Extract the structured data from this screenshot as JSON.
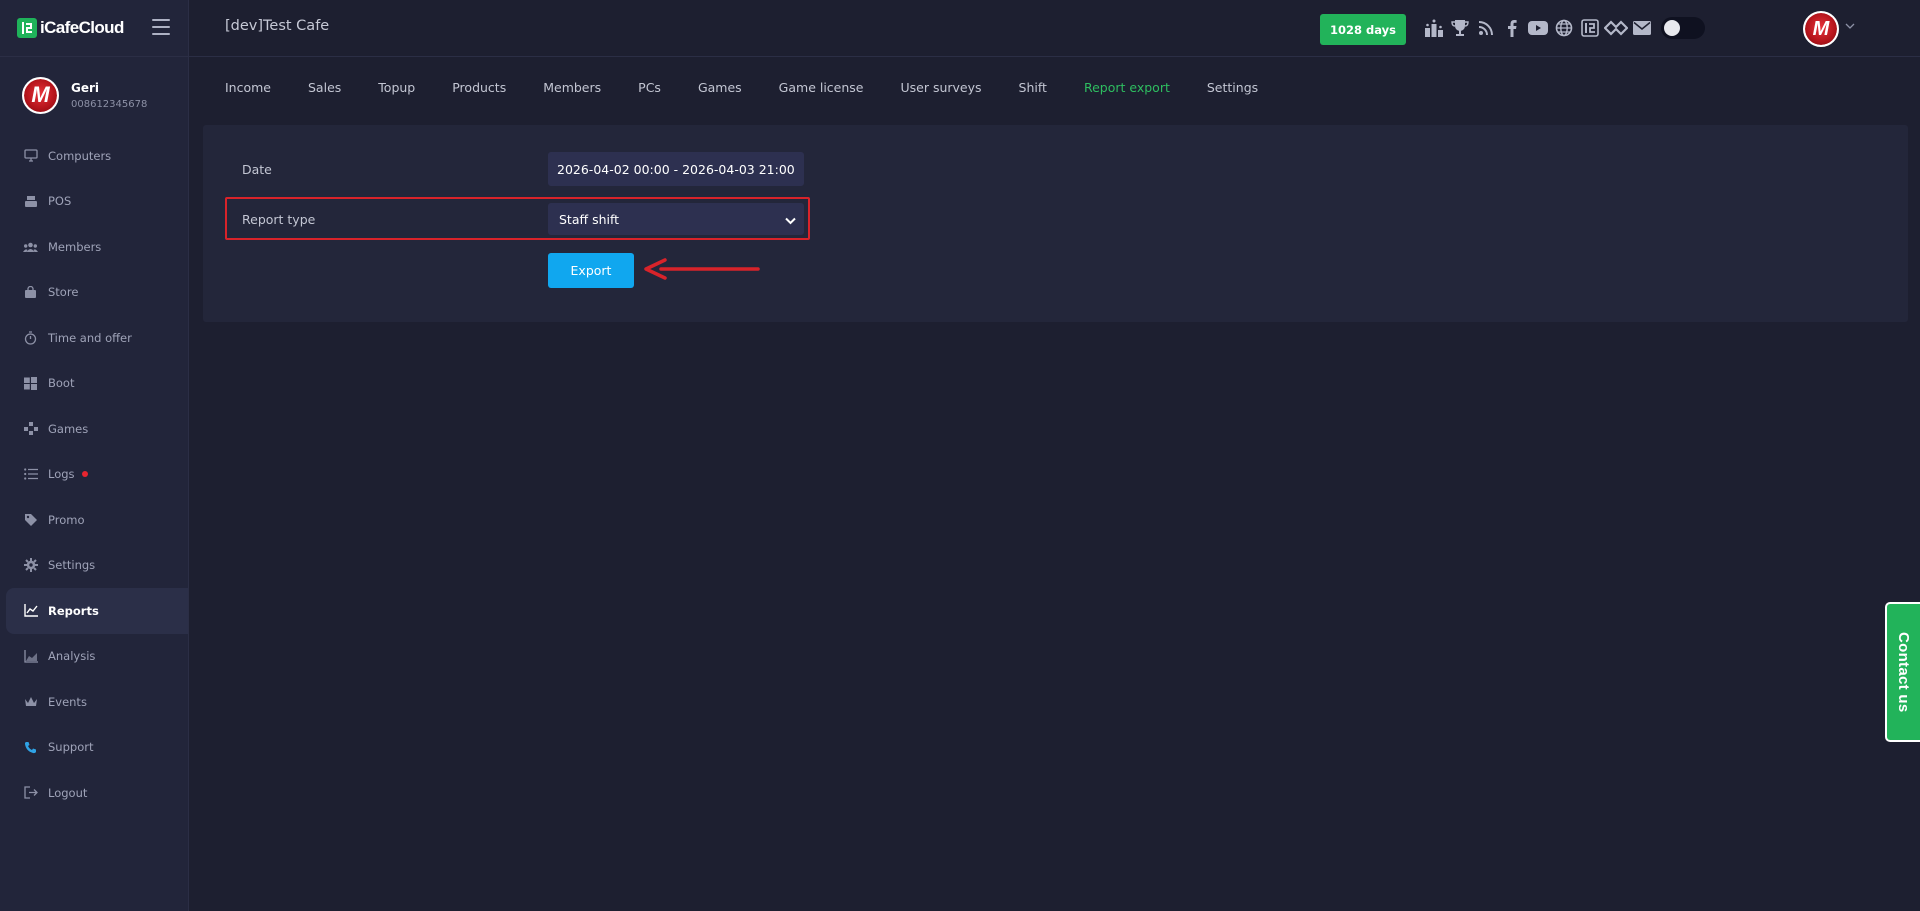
{
  "brand": {
    "name": "iCafeCloud"
  },
  "profile": {
    "name": "Geri",
    "id": "008612345678"
  },
  "sidebar": {
    "items": [
      {
        "label": "Computers",
        "icon": "monitor-icon"
      },
      {
        "label": "POS",
        "icon": "cash-register-icon"
      },
      {
        "label": "Members",
        "icon": "users-icon"
      },
      {
        "label": "Store",
        "icon": "shopping-bag-icon"
      },
      {
        "label": "Time and offer",
        "icon": "stopwatch-icon"
      },
      {
        "label": "Boot",
        "icon": "windows-icon"
      },
      {
        "label": "Games",
        "icon": "gamepad-icon"
      },
      {
        "label": "Logs",
        "icon": "list-icon"
      },
      {
        "label": "Promo",
        "icon": "tag-icon"
      },
      {
        "label": "Settings",
        "icon": "gear-icon"
      },
      {
        "label": "Reports",
        "icon": "chart-line-icon"
      },
      {
        "label": "Analysis",
        "icon": "chart-area-icon"
      },
      {
        "label": "Events",
        "icon": "crown-icon"
      },
      {
        "label": "Support",
        "icon": "phone-icon"
      },
      {
        "label": "Logout",
        "icon": "logout-icon"
      }
    ],
    "active": "Reports"
  },
  "topbar": {
    "cafe_name": "[dev]Test Cafe",
    "days_badge": "1028 days",
    "icons": [
      "ranking-icon",
      "trophy-icon",
      "rss-icon",
      "facebook-icon",
      "youtube-icon",
      "globe-icon",
      "icafe-logo-icon",
      "handshake-icon",
      "mail-icon"
    ],
    "theme_toggle": "off"
  },
  "tabs": [
    {
      "label": "Income"
    },
    {
      "label": "Sales"
    },
    {
      "label": "Topup"
    },
    {
      "label": "Products"
    },
    {
      "label": "Members"
    },
    {
      "label": "PCs"
    },
    {
      "label": "Games"
    },
    {
      "label": "Game license"
    },
    {
      "label": "User surveys"
    },
    {
      "label": "Shift"
    },
    {
      "label": "Report export"
    },
    {
      "label": "Settings"
    }
  ],
  "active_tab": "Report export",
  "form": {
    "date_label": "Date",
    "date_value": "2026-04-02 00:00 - 2026-04-03 21:00",
    "report_type_label": "Report type",
    "report_type_value": "Staff shift",
    "export_label": "Export"
  },
  "contact": {
    "label": "Contact us"
  },
  "colors": {
    "accent_green": "#22b35a",
    "active_tab": "#2ebd60",
    "export_blue": "#10a7ef",
    "highlight_red": "#d8232a"
  }
}
